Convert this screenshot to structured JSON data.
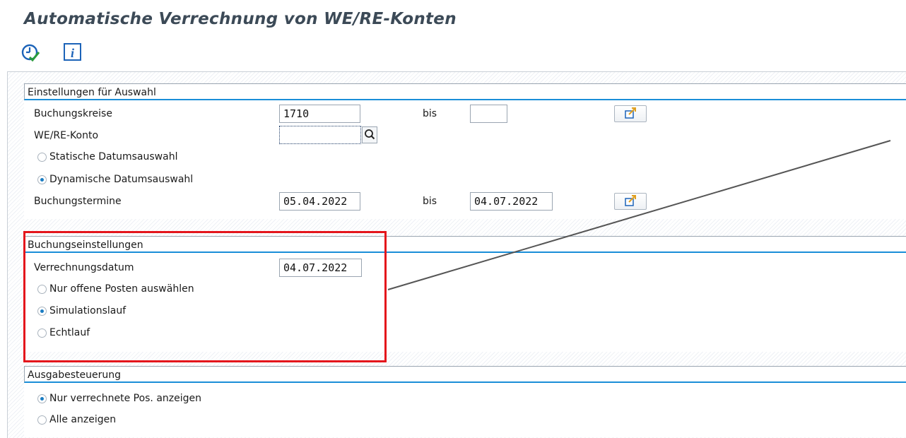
{
  "page": {
    "title": "Automatische Verrechnung von WE/RE-Konten"
  },
  "toolbar": {
    "icons": [
      "execute-clock-icon",
      "info-icon"
    ]
  },
  "selection": {
    "header": "Einstellungen für Auswahl",
    "company_codes_label": "Buchungskreise",
    "company_codes_from": "1710",
    "company_codes_to": "",
    "bis_label": "bis",
    "account_label": "WE/RE-Konto",
    "account_value": "",
    "static_date_label": "Statische Datumsauswahl",
    "dynamic_date_label": "Dynamische Datumsauswahl",
    "selected_date_mode": "dynamic",
    "posting_dates_label": "Buchungstermine",
    "posting_dates_from": "05.04.2022",
    "posting_dates_to": "04.07.2022"
  },
  "posting": {
    "header": "Buchungseinstellungen",
    "clearing_date_label": "Verrechnungsdatum",
    "clearing_date_value": "04.07.2022",
    "open_items_label": "Nur offene Posten auswählen",
    "simulation_label": "Simulationslauf",
    "real_run_label": "Echtlauf",
    "selected_run": "simulation"
  },
  "output": {
    "header": "Ausgabesteuerung",
    "cleared_only_label": "Nur verrechnete Pos. anzeigen",
    "all_label": "Alle anzeigen",
    "selected_output": "cleared_only"
  },
  "colors": {
    "accent": "#1a8ed8",
    "highlight": "#e4161c",
    "title": "#3c4a57"
  }
}
